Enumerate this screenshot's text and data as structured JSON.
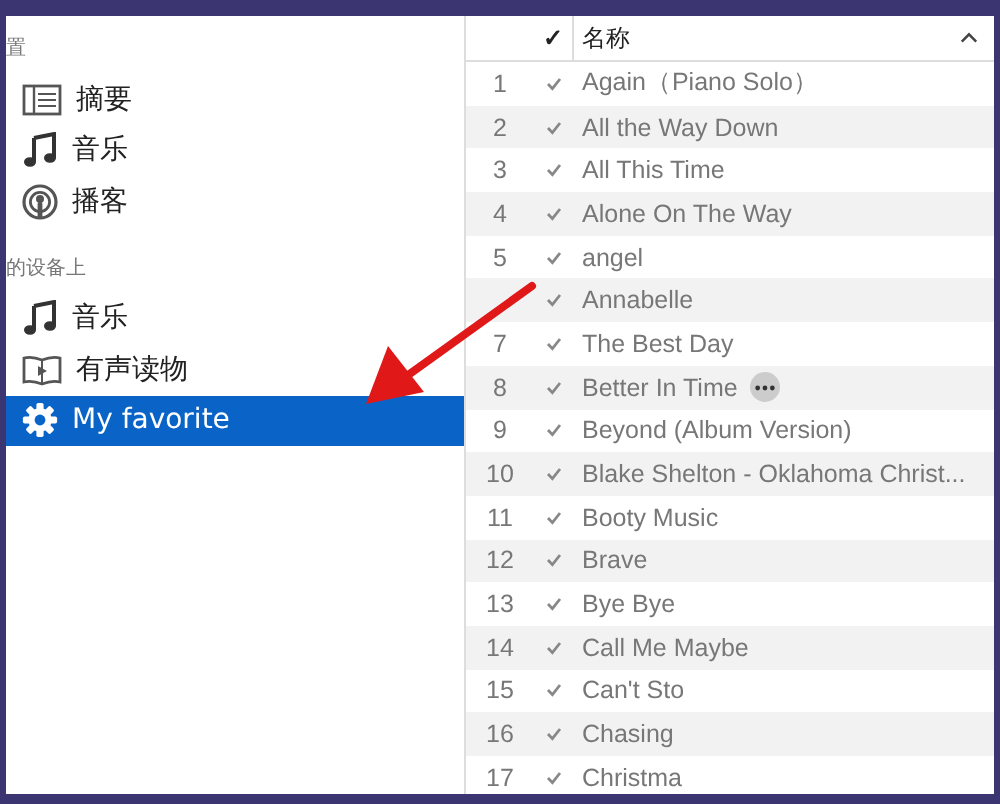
{
  "sidebar": {
    "sections": [
      {
        "heading": "置",
        "items": [
          {
            "kind": "list",
            "label": "摘要",
            "selected": false
          },
          {
            "kind": "note",
            "label": "音乐",
            "selected": false
          },
          {
            "kind": "podcast",
            "label": "播客",
            "selected": false
          }
        ]
      },
      {
        "heading": "的设备上",
        "items": [
          {
            "kind": "note",
            "label": "音乐",
            "selected": false
          },
          {
            "kind": "book",
            "label": "有声读物",
            "selected": false
          },
          {
            "kind": "gear",
            "label": "My favorite",
            "selected": true
          }
        ]
      }
    ]
  },
  "table": {
    "columns": [
      {
        "label": "✓"
      },
      {
        "label": "名称"
      }
    ],
    "rows": [
      {
        "number": "1",
        "checked": true,
        "title": "Again（Piano Solo）"
      },
      {
        "number": "2",
        "checked": true,
        "title": "All the Way Down"
      },
      {
        "number": "3",
        "checked": true,
        "title": "All This Time"
      },
      {
        "number": "4",
        "checked": true,
        "title": "Alone On The Way"
      },
      {
        "number": "5",
        "checked": true,
        "title": "angel"
      },
      {
        "checked": true,
        "title": "Annabelle"
      },
      {
        "number": "7",
        "checked": true,
        "title": "The Best Day"
      },
      {
        "number": "8",
        "checked": true,
        "title": "Better In Time",
        "more": true
      },
      {
        "number": "9",
        "checked": true,
        "title": "Beyond (Album Version)"
      },
      {
        "number": "10",
        "checked": true,
        "title": "Blake Shelton  - Oklahoma Christ..."
      },
      {
        "number": "11",
        "checked": true,
        "title": "Booty Music"
      },
      {
        "number": "12",
        "checked": true,
        "title": "Brave"
      },
      {
        "number": "13",
        "checked": true,
        "title": "Bye Bye"
      },
      {
        "number": "14",
        "checked": true,
        "title": "Call Me Maybe"
      },
      {
        "number": "15",
        "checked": true,
        "title": "Can't Sto"
      },
      {
        "number": "16",
        "checked": true,
        "title": "Chasing"
      },
      {
        "number": "17",
        "checked": true,
        "title": "Christma"
      }
    ]
  },
  "annotation": {
    "kind": "arrow"
  }
}
